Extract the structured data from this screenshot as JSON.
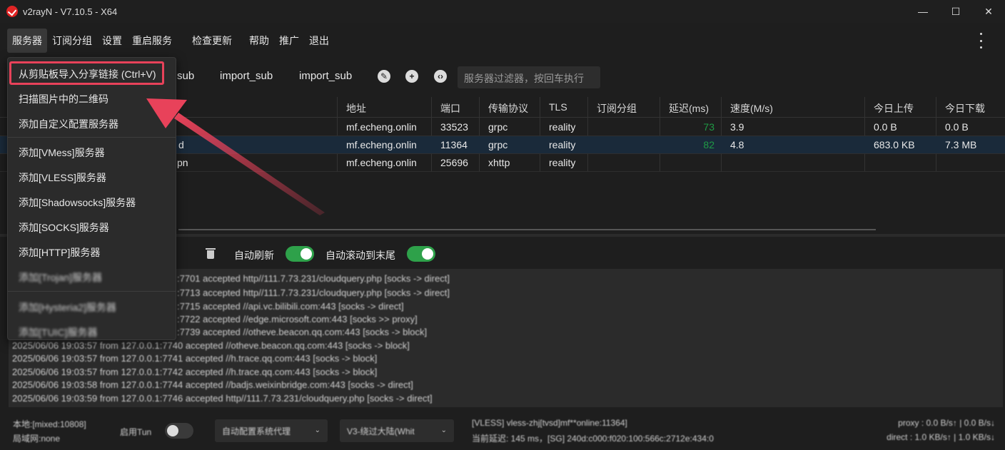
{
  "window": {
    "title": "v2rayN - V7.10.5 - X64",
    "controls": [
      "—",
      "☐",
      "✕"
    ]
  },
  "menu": {
    "items": [
      "服务器",
      "订阅分组",
      "设置",
      "重启服务",
      "检查更新",
      "帮助",
      "推广",
      "退出"
    ]
  },
  "toolbar": {
    "tabs": [
      "sub",
      "import_sub",
      "import_sub"
    ],
    "filter_placeholder": "服务器过滤器，按回车执行"
  },
  "table": {
    "headers": [
      "地址",
      "端口",
      "传输协议",
      "TLS",
      "订阅分组",
      "延迟(ms)",
      "速度(M/s)",
      "今日上传",
      "今日下载"
    ],
    "rows": [
      {
        "name": "",
        "address": "mf.echeng.onlin",
        "port": "33523",
        "network": "grpc",
        "tls": "reality",
        "sub": "",
        "latency": "73",
        "speed": "3.9",
        "up": "0.0 B",
        "down": "0.0 B"
      },
      {
        "name": "d",
        "address": "mf.echeng.onlin",
        "port": "11364",
        "network": "grpc",
        "tls": "reality",
        "sub": "",
        "latency": "82",
        "speed": "4.8",
        "up": "683.0 KB",
        "down": "7.3 MB"
      },
      {
        "name": "pn",
        "address": "mf.echeng.onlin",
        "port": "25696",
        "network": "xhttp",
        "tls": "reality",
        "sub": "",
        "latency": "",
        "speed": "",
        "up": "",
        "down": ""
      }
    ]
  },
  "logbar": {
    "auto_refresh": "自动刷新",
    "auto_scroll": "自动滚动到末尾"
  },
  "log_lines": [
    ":7701 accepted http//111.7.73.231/cloudquery.php [socks -> direct]",
    ":7713 accepted http//111.7.73.231/cloudquery.php [socks -> direct]",
    ":7715 accepted //api.vc.bilibili.com:443 [socks -> direct]",
    ":7722 accepted //edge.microsoft.com:443 [socks >> proxy]",
    ":7739 accepted //otheve.beacon.qq.com:443 [socks -> block]",
    "2025/06/06 19:03:57 from 127.0.0.1:7740 accepted //otheve.beacon.qq.com:443 [socks -> block]",
    "2025/06/06 19:03:57 from 127.0.0.1:7741 accepted //h.trace.qq.com:443 [socks -> block]",
    "2025/06/06 19:03:57 from 127.0.0.1:7742 accepted //h.trace.qq.com:443 [socks -> block]",
    "2025/06/06 19:03:58 from 127.0.0.1:7744 accepted //badjs.weixinbridge.com:443 [socks -> direct]",
    "2025/06/06 19:03:59 from 127.0.0.1:7746 accepted http//111.7.73.231/cloudquery.php [socks -> direct]"
  ],
  "statusbar": {
    "local": "本地:[mixed:10808]",
    "lan": "局域网:none",
    "tun_label": "启用Tun",
    "proxy_mode": "自动配置系统代理",
    "routing": "V3-绕过大陆(Whit",
    "server_info": "[VLESS] vless-zhj[tvsd]mf**online:11364]",
    "latency_info": "当前延迟: 145 ms，[SG] 240d:c000:f020:100:566c:2712e:434:0",
    "proxy_speed": "proxy : 0.0 B/s↑ | 0.0 B/s↓",
    "direct_speed": "direct : 1.0 KB/s↑ | 1.0 KB/s↓"
  },
  "server_menu": {
    "items": [
      "从剪贴板导入分享链接 (Ctrl+V)",
      "扫描图片中的二维码",
      "添加自定义配置服务器",
      "添加[VMess]服务器",
      "添加[VLESS]服务器",
      "添加[Shadowsocks]服务器",
      "添加[SOCKS]服务器",
      "添加[HTTP]服务器",
      "添加[Trojan]服务器",
      "添加[Hysteria2]服务器",
      "添加[TUIC]服务器"
    ]
  },
  "colors": {
    "accent_green": "#2ea14a",
    "highlight_red": "#e8425a",
    "latency_green": "#1f9a45"
  }
}
